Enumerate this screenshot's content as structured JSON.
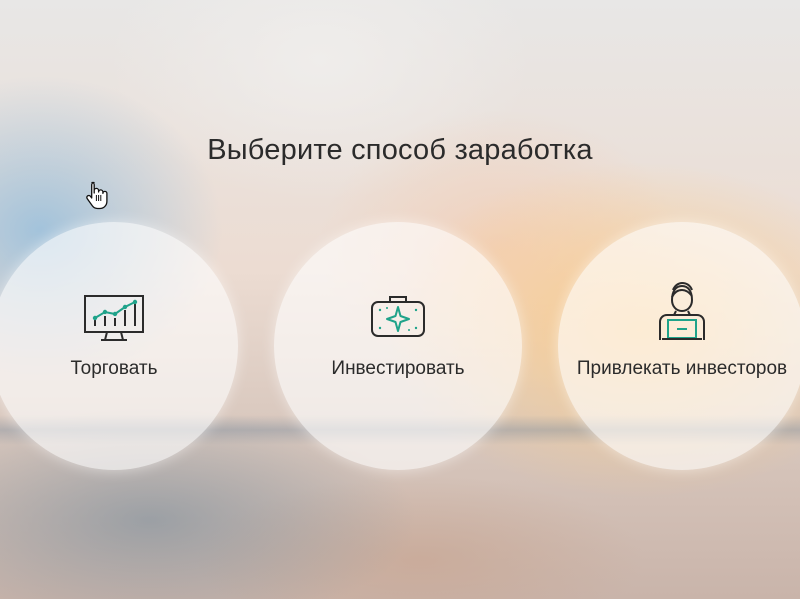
{
  "page": {
    "title": "Выберите способ заработка"
  },
  "options": [
    {
      "label": "Торговать",
      "icon": "chart-monitor-icon"
    },
    {
      "label": "Инвестировать",
      "icon": "briefcase-sparkle-icon"
    },
    {
      "label": "Привлекать инвесторов",
      "icon": "person-laptop-icon"
    }
  ],
  "colors": {
    "accent": "#1fa38a",
    "text": "#2b2b2b",
    "icon_stroke": "#2b2b2b"
  }
}
